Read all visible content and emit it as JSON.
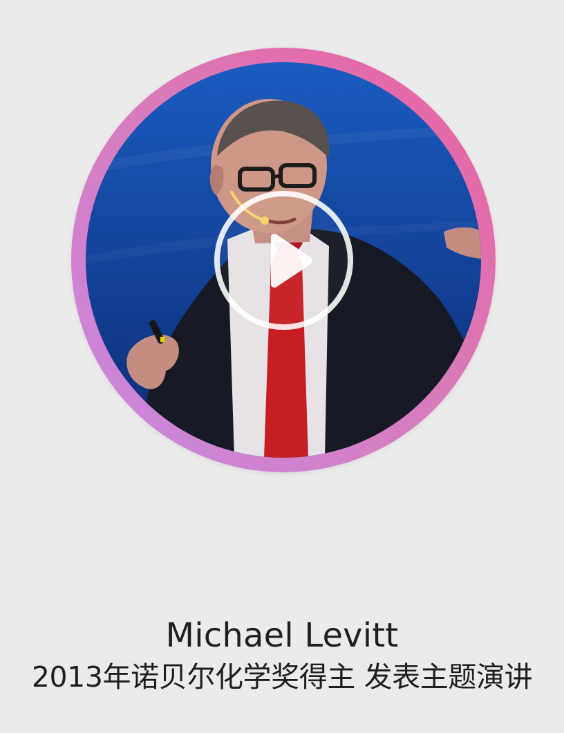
{
  "video": {
    "thumbnail_subject": "Michael Levitt speaking on stage",
    "play_icon": "play-icon",
    "ring_gradient": [
      "#ec609f",
      "#d97ab9",
      "#c989e3"
    ],
    "background_color": "#ebebeb"
  },
  "caption": {
    "name": "Michael Levitt",
    "description": "2013年诺贝尔化学奖得主 发表主题演讲"
  }
}
